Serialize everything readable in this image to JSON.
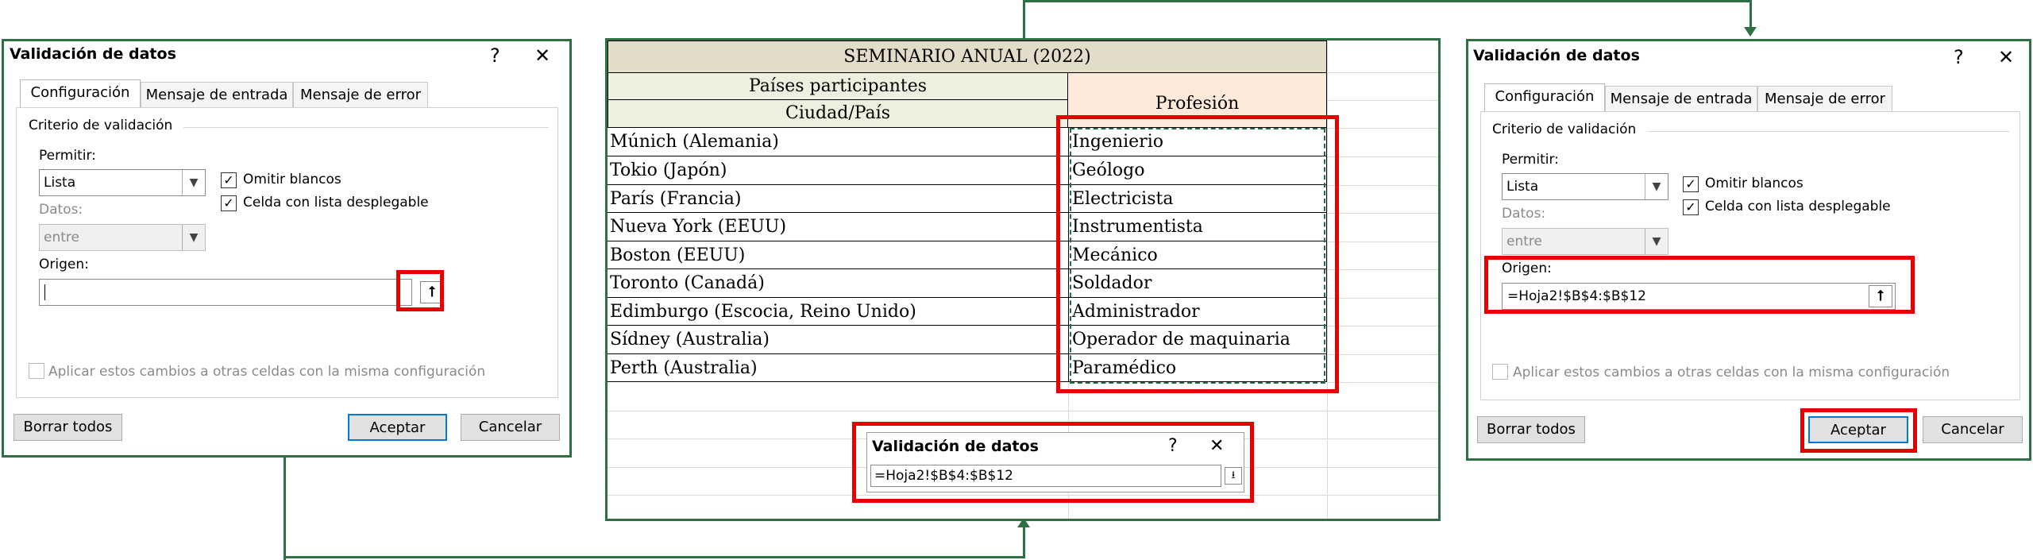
{
  "dialog_left": {
    "title": "Validación de datos",
    "help": "?",
    "close": "✕",
    "tabs": [
      "Configuración",
      "Mensaje de entrada",
      "Mensaje de error"
    ],
    "section": "Criterio de validación",
    "permitir_label": "Permitir:",
    "permitir_value": "Lista",
    "omitir": "Omitir blancos",
    "celda": "Celda con lista desplegable",
    "datos_label": "Datos:",
    "datos_value": "entre",
    "origen_label": "Origen:",
    "origen_value": "",
    "aplicar": "Aplicar estos cambios a otras celdas con la misma configuración",
    "borrar": "Borrar todos",
    "aceptar": "Aceptar",
    "cancelar": "Cancelar"
  },
  "sheet": {
    "title": "SEMINARIO ANUAL  (2022)",
    "header_paises": "Países participantes",
    "header_ciudad": "Ciudad/País",
    "header_profesion": "Profesión",
    "cities": [
      "Múnich (Alemania)",
      "Tokio (Japón)",
      "París (Francia)",
      "Nueva York (EEUU)",
      "Boston (EEUU)",
      "Toronto (Canadá)",
      "Edimburgo (Escocia, Reino Unido)",
      "Sídney (Australia)",
      "Perth (Australia)"
    ],
    "professions": [
      "Ingenierio",
      "Geólogo",
      "Electricista",
      "Instrumentista",
      "Mecánico",
      "Soldador",
      "Administrador",
      "Operador de maquinaria",
      "Paramédico"
    ]
  },
  "mini_dialog": {
    "title": "Validación de datos",
    "help": "?",
    "close": "✕",
    "value": "=Hoja2!$B$4:$B$12"
  },
  "dialog_right": {
    "title": "Validación de datos",
    "help": "?",
    "close": "✕",
    "tabs": [
      "Configuración",
      "Mensaje de entrada",
      "Mensaje de error"
    ],
    "section": "Criterio de validación",
    "permitir_label": "Permitir:",
    "permitir_value": "Lista",
    "omitir": "Omitir blancos",
    "celda": "Celda con lista desplegable",
    "datos_label": "Datos:",
    "datos_value": "entre",
    "origen_label": "Origen:",
    "origen_value": "=Hoja2!$B$4:$B$12",
    "aplicar": "Aplicar estos cambios a otras celdas con la misma configuración",
    "borrar": "Borrar todos",
    "aceptar": "Aceptar",
    "cancelar": "Cancelar"
  },
  "colors": {
    "frame": "#2e6f44",
    "highlight": "#e60000",
    "title_fill": "#e2dcc8",
    "header_green": "#ebf1de",
    "header_peach": "#fde9d9",
    "accent": "#0078d7"
  }
}
